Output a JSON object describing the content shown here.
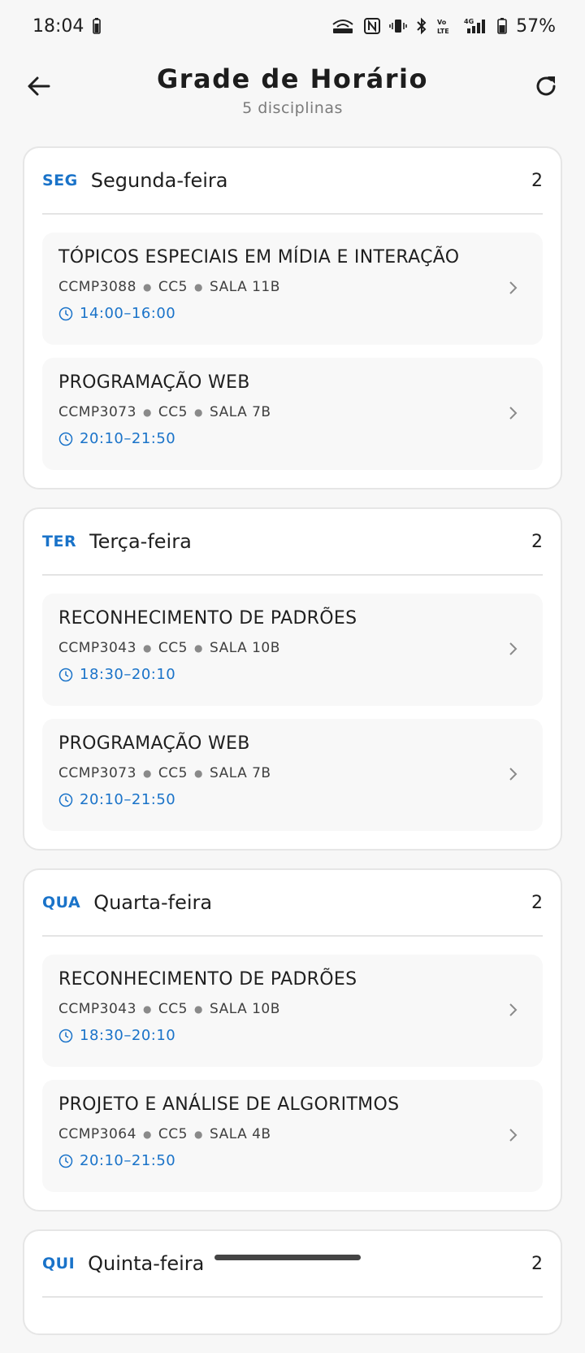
{
  "status_bar": {
    "time": "18:04",
    "battery_percent": "57%"
  },
  "app_bar": {
    "title": "Grade de Horário",
    "subtitle": "5 disciplinas"
  },
  "days": [
    {
      "abbr": "SEG",
      "name": "Segunda-feira",
      "count": "2",
      "classes": [
        {
          "title": "TÓPICOS ESPECIAIS EM MÍDIA E INTERAÇÃO",
          "code": "CCMP3088",
          "group": "CC5",
          "room": "SALA 11B",
          "time": "14:00–16:00"
        },
        {
          "title": "PROGRAMAÇÃO WEB",
          "code": "CCMP3073",
          "group": "CC5",
          "room": "SALA 7B",
          "time": "20:10–21:50"
        }
      ]
    },
    {
      "abbr": "TER",
      "name": "Terça-feira",
      "count": "2",
      "classes": [
        {
          "title": "RECONHECIMENTO DE PADRÕES",
          "code": "CCMP3043",
          "group": "CC5",
          "room": "SALA 10B",
          "time": "18:30–20:10"
        },
        {
          "title": "PROGRAMAÇÃO WEB",
          "code": "CCMP3073",
          "group": "CC5",
          "room": "SALA 7B",
          "time": "20:10–21:50"
        }
      ]
    },
    {
      "abbr": "QUA",
      "name": "Quarta-feira",
      "count": "2",
      "classes": [
        {
          "title": "RECONHECIMENTO DE PADRÕES",
          "code": "CCMP3043",
          "group": "CC5",
          "room": "SALA 10B",
          "time": "18:30–20:10"
        },
        {
          "title": "PROJETO E ANÁLISE DE ALGORITMOS",
          "code": "CCMP3064",
          "group": "CC5",
          "room": "SALA 4B",
          "time": "20:10–21:50"
        }
      ]
    },
    {
      "abbr": "QUI",
      "name": "Quinta-feira",
      "count": "2",
      "classes": []
    }
  ],
  "colors": {
    "accent": "#1a73c9",
    "background": "#f7f7f7",
    "card": "#ffffff"
  }
}
